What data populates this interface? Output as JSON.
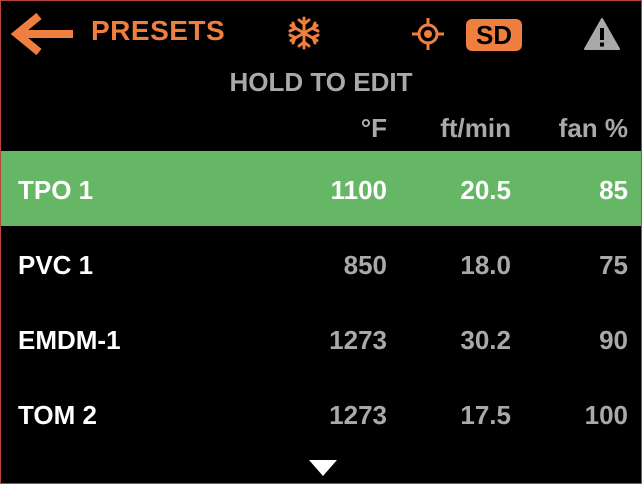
{
  "colors": {
    "accent": "#ef7f3f",
    "selected_row": "#66b765",
    "header_text": "#a9a9a9",
    "value_text": "#a9a9a9",
    "label_text": "#ffffff"
  },
  "header": {
    "title": "PRESETS",
    "back_icon": "arrow-left-icon",
    "snow_icon": "snowflake-icon",
    "target_icon": "crosshair-icon",
    "sd_label": "SD",
    "warning_icon": "warning-triangle-icon"
  },
  "subtitle": "HOLD TO EDIT",
  "columns": {
    "temp": "°F",
    "speed": "ft/min",
    "fan": "fan %"
  },
  "rows": [
    {
      "name": "TPO 1",
      "temp": "1100",
      "speed": "20.5",
      "fan": "85",
      "selected": true
    },
    {
      "name": "PVC 1",
      "temp": "850",
      "speed": "18.0",
      "fan": "75",
      "selected": false
    },
    {
      "name": "EMDM-1",
      "temp": "1273",
      "speed": "30.2",
      "fan": "90",
      "selected": false
    },
    {
      "name": "TOM 2",
      "temp": "1273",
      "speed": "17.5",
      "fan": "100",
      "selected": false
    }
  ],
  "scroll_icon": "triangle-down-icon"
}
